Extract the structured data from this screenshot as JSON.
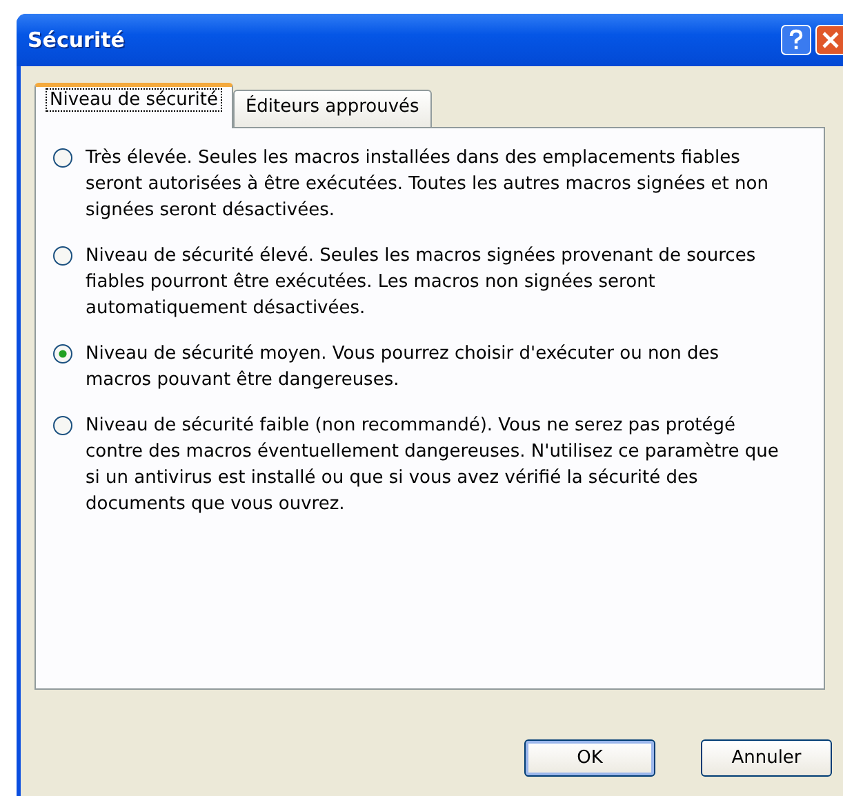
{
  "window": {
    "title": "Sécurité"
  },
  "tabs": [
    {
      "label": "Niveau de sécurité",
      "selected": true
    },
    {
      "label": "Éditeurs approuvés",
      "selected": false
    }
  ],
  "options": [
    {
      "text": "Très élevée. Seules les macros installées dans des emplacements fiables seront autorisées à être exécutées. Toutes les autres macros signées et non signées seront désactivées.",
      "selected": false
    },
    {
      "text": "Niveau de sécurité élevé. Seules les macros signées provenant de sources fiables pourront être exécutées. Les macros non signées seront automatiquement désactivées.",
      "selected": false
    },
    {
      "text": "Niveau de sécurité moyen. Vous pourrez choisir d'exécuter ou non des macros pouvant être dangereuses.",
      "selected": true
    },
    {
      "text": "Niveau de sécurité faible (non recommandé). Vous ne serez pas protégé contre des macros éventuellement dangereuses. N'utilisez ce paramètre que si un antivirus est installé ou que si vous avez vérifié la sécurité des documents que vous ouvrez.",
      "selected": false
    }
  ],
  "buttons": [
    {
      "label": "OK",
      "default": true
    },
    {
      "label": "Annuler",
      "default": false
    }
  ]
}
